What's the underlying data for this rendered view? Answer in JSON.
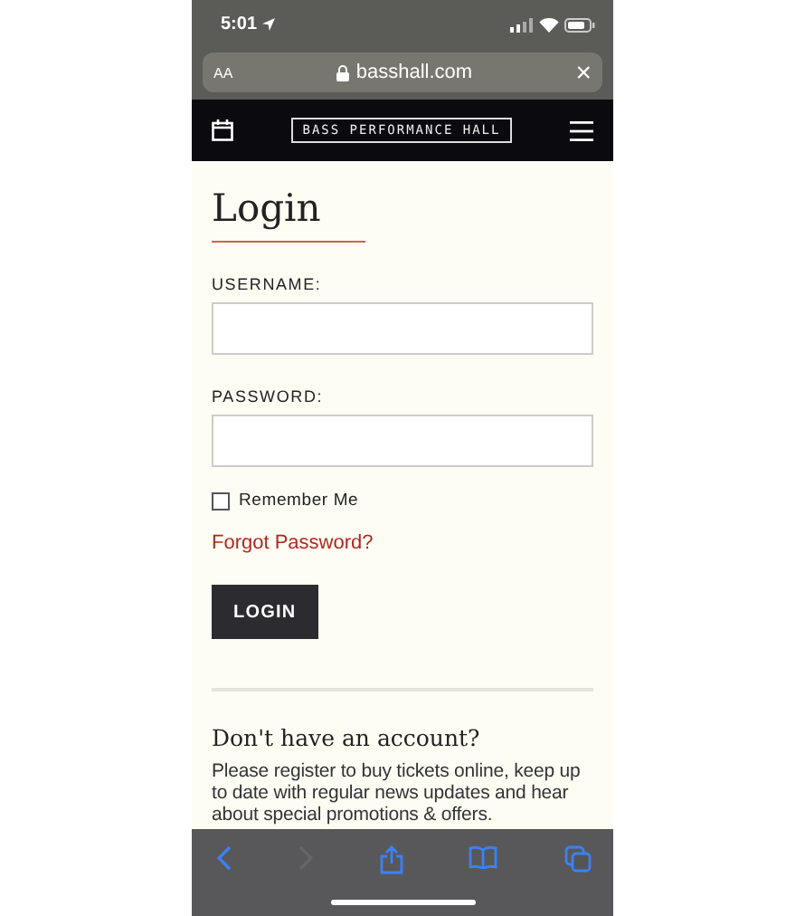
{
  "status_bar": {
    "time": "5:01"
  },
  "address_bar": {
    "text_size": "AA",
    "url": "basshall.com",
    "close": "×"
  },
  "site_header": {
    "logo": "BASS PERFORMANCE HALL"
  },
  "login": {
    "title": "Login",
    "fields": [
      {
        "label": "USERNAME:"
      },
      {
        "label": "PASSWORD:"
      }
    ],
    "remember": {
      "label": "Remember Me",
      "checked": false
    },
    "forgot_link": "Forgot Password?",
    "button": "LOGIN"
  },
  "register": {
    "heading": "Don't have an account?",
    "text": "Please register to buy tickets online, keep up to date with regular news updates and hear about special promotions & offers."
  },
  "toolbar": [
    {
      "kind": "back",
      "disabled": false
    },
    {
      "kind": "forward",
      "disabled": true
    },
    {
      "kind": "share",
      "disabled": false
    },
    {
      "kind": "bookmarks",
      "disabled": false
    },
    {
      "kind": "tabs",
      "disabled": false
    }
  ]
}
